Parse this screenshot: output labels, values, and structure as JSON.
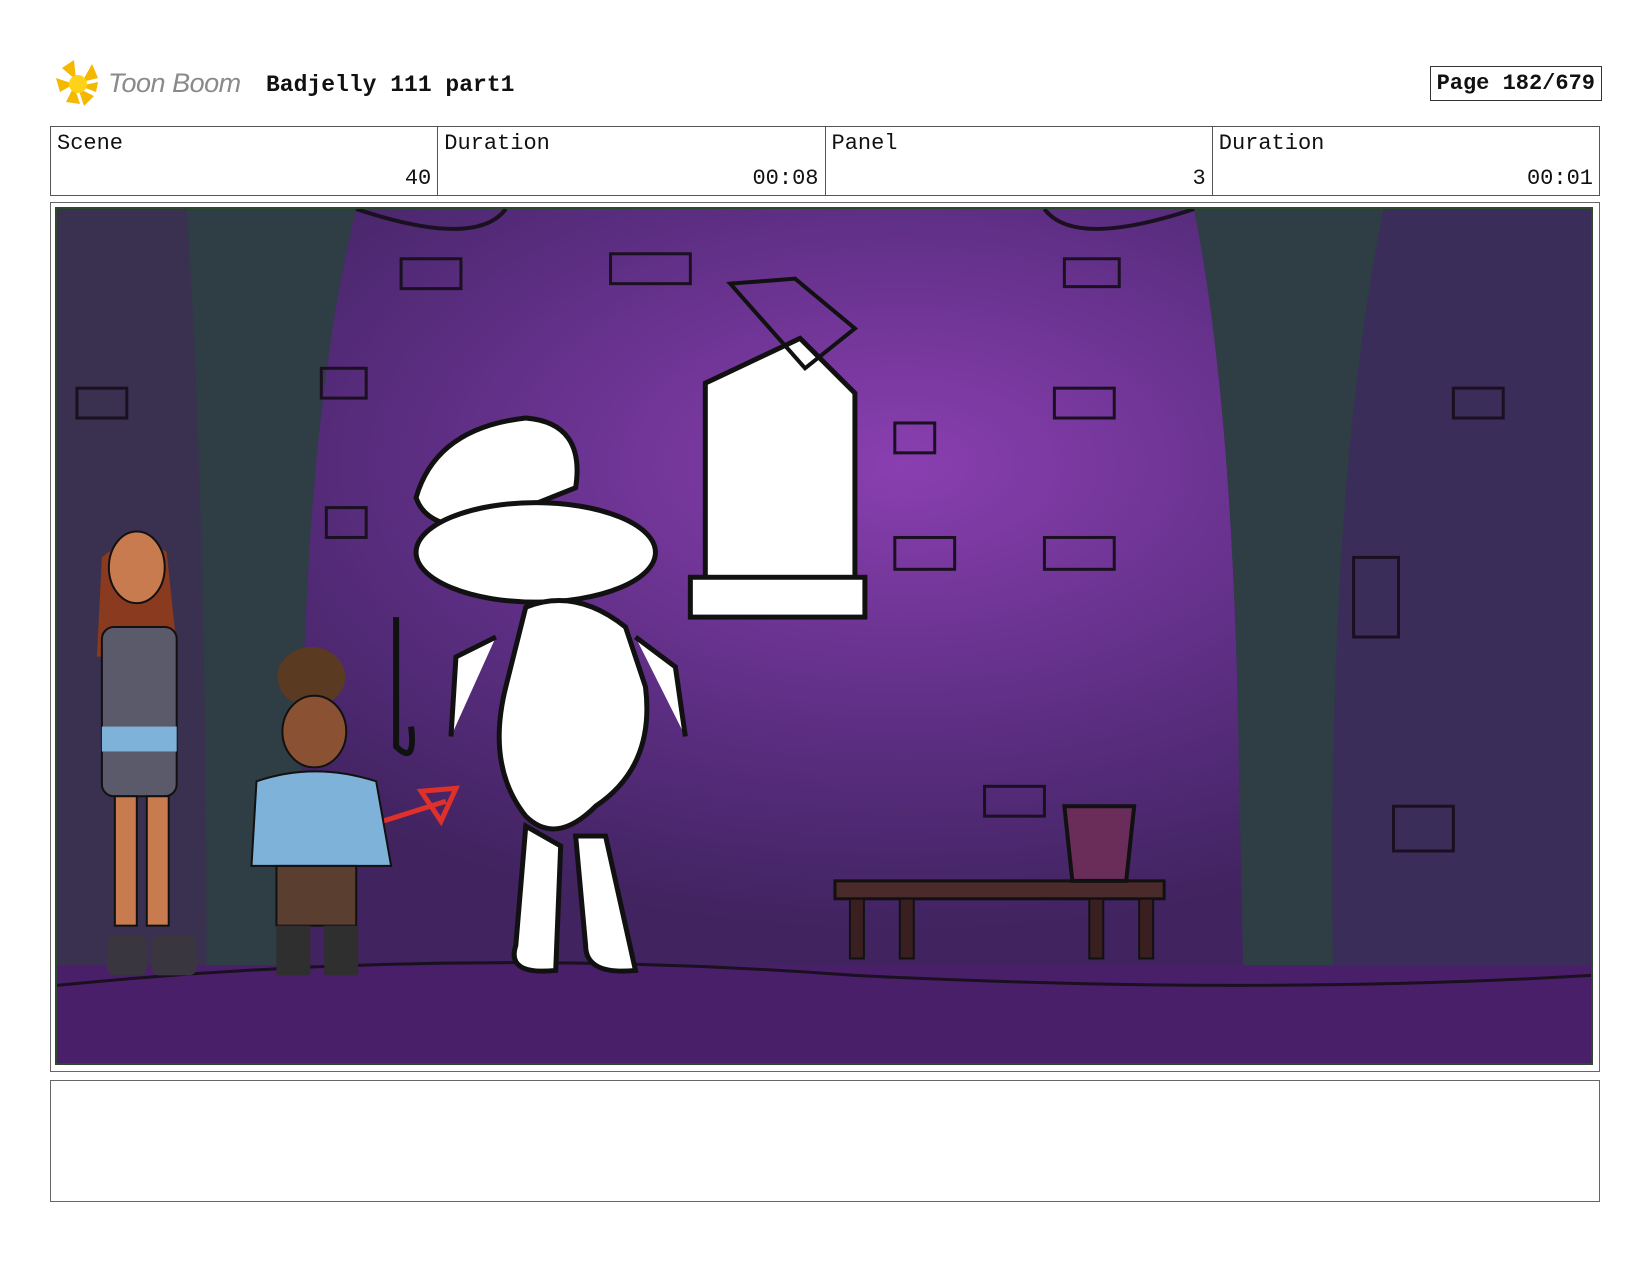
{
  "header": {
    "logo_text": "Toon Boom",
    "title": "Badjelly 111 part1",
    "page": "Page 182/679"
  },
  "info": {
    "scene_label": "Scene",
    "scene_value": "40",
    "duration_label": "Duration",
    "duration_value": "00:08",
    "panel_label": "Panel",
    "panel_value": "3",
    "panel_duration_label": "Duration",
    "panel_duration_value": "00:01"
  },
  "panel_image": {
    "description_icon": "storyboard-panel-image",
    "colors": {
      "wall_purple": "#5a2d80",
      "glow_purple": "#8a3fb0",
      "pillar_dark": "#2f3d45",
      "sketch_white": "#ffffff",
      "arrow_red": "#e0302a"
    }
  },
  "notes": {
    "text": ""
  }
}
